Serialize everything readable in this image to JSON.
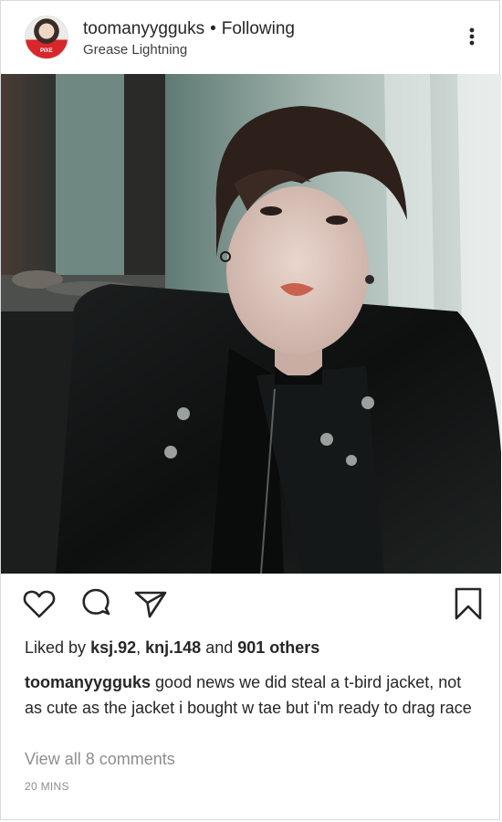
{
  "header": {
    "username": "toomanyygguks",
    "separator": "•",
    "follow_status": "Following",
    "location": "Grease Lightning",
    "avatar_icon": "profile-avatar",
    "avatar_text": "PIXE",
    "more_icon": "more-vertical-icon"
  },
  "actions": {
    "like_icon": "heart-icon",
    "comment_icon": "comment-icon",
    "share_icon": "send-icon",
    "save_icon": "bookmark-icon"
  },
  "likes": {
    "prefix": "Liked by",
    "user1": "ksj.92",
    "comma": ",",
    "user2": "knj.148",
    "and": "and",
    "others": "901 others"
  },
  "caption": {
    "username": "toomanyygguks",
    "text": "good news we did steal a t-bird jacket, not as cute as the jacket i bought w tae but i'm ready to drag race"
  },
  "comments": {
    "view_all": "View all 8 comments"
  },
  "timestamp": "20 MINS",
  "colors": {
    "text": "#262626",
    "muted": "#8e8e8e",
    "border": "#d9d9d9"
  }
}
